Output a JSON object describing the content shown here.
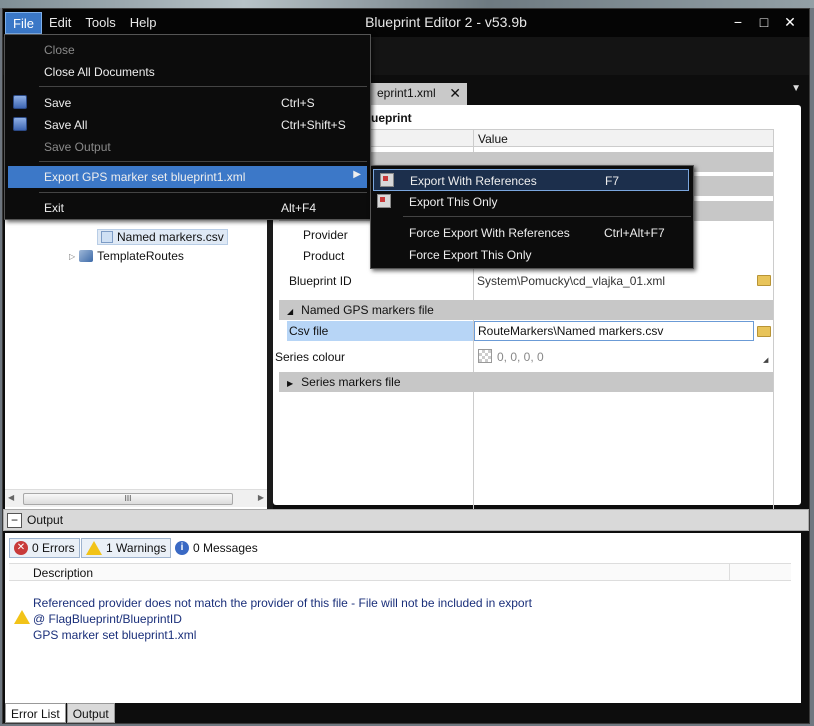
{
  "window": {
    "title": "Blueprint Editor 2 - v53.9b",
    "minimize": "−",
    "maximize": "□",
    "close": "✕"
  },
  "menubar": [
    "File",
    "Edit",
    "Tools",
    "Help"
  ],
  "file_menu": {
    "close": "Close",
    "close_all": "Close All Documents",
    "save": {
      "label": "Save",
      "shortcut": "Ctrl+S"
    },
    "save_all": {
      "label": "Save All",
      "shortcut": "Ctrl+Shift+S"
    },
    "save_output": "Save Output",
    "export": "Export GPS marker set blueprint1.xml",
    "exit": {
      "label": "Exit",
      "shortcut": "Alt+F4"
    }
  },
  "export_submenu": {
    "export_with_refs": {
      "label": "Export With References",
      "shortcut": "F7"
    },
    "export_only": {
      "label": "Export This Only"
    },
    "force_with_refs": {
      "label": "Force Export With References",
      "shortcut": "Ctrl+Alt+F7"
    },
    "force_only": {
      "label": "Force Export This Only"
    }
  },
  "tree": {
    "named_markers": "Named markers.csv",
    "template_routes": "TemplateRoutes",
    "scroll_grip": "III"
  },
  "document": {
    "tab": "eprint1.xml",
    "tab_close": "✕",
    "breadcrumb": "ueprint",
    "value_header": "Value",
    "provider_label": "Provider",
    "product_label": "Product",
    "blueprint_id_label": "Blueprint ID",
    "blueprint_id_value": "System\\Pomucky\\cd_vlajka_01.xml",
    "named_gps_section": "Named GPS markers file",
    "csv_label": "Csv file",
    "csv_value": "RouteMarkers\\Named markers.csv",
    "series_colour_label": "Series colour",
    "series_colour_value": "0, 0, 0, 0",
    "series_markers_section": "Series markers file"
  },
  "output": {
    "title": "Output",
    "errors": "0 Errors",
    "warnings": "1 Warnings",
    "messages": "0 Messages",
    "description_header": "Description",
    "messages_list": [
      "Referenced provider does not match the provider of this file - File will not be included in export",
      "@ FlagBlueprint/BlueprintID",
      "GPS marker set blueprint1.xml"
    ],
    "tabs": [
      "Error List",
      "Output"
    ]
  },
  "colors": {
    "accent": "#3c78c8",
    "selection": "#b7d5f6",
    "warning": "#f2c318",
    "error": "#c83a3a"
  }
}
